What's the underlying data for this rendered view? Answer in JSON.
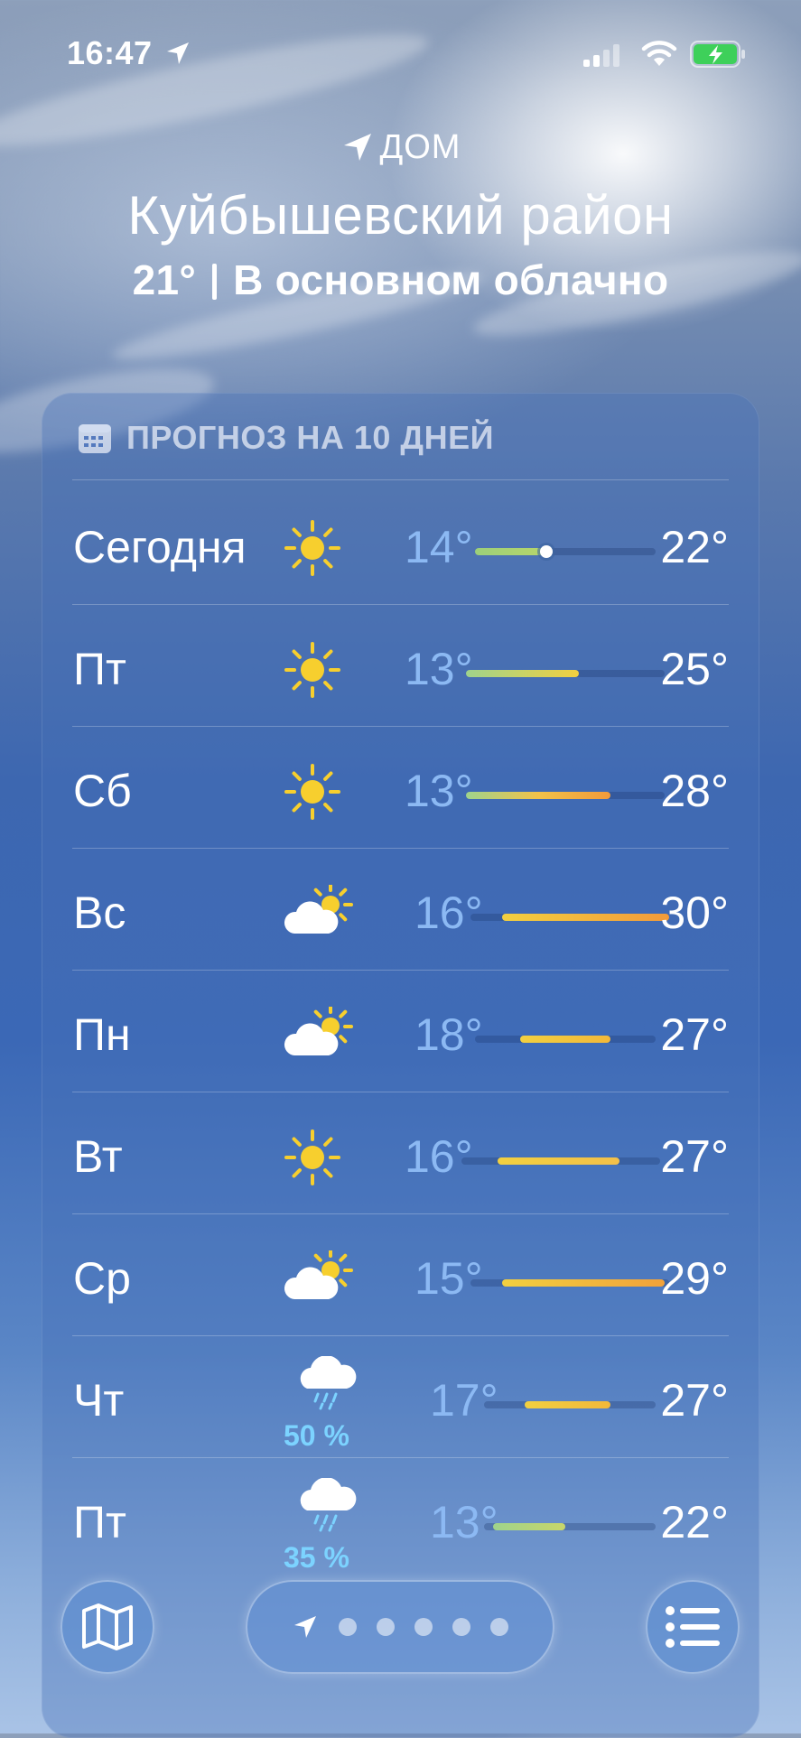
{
  "status_bar": {
    "time": "16:47"
  },
  "header": {
    "home_label": "ДОМ",
    "city": "Куйбышевский район",
    "current_temp": "21°",
    "condition": "В основном облачно"
  },
  "forecast": {
    "title": "ПРОГНОЗ НА 10 ДНЕЙ",
    "days": [
      {
        "day": "Сегодня",
        "icon": "sun-icon",
        "low": "14°",
        "high": "22°",
        "precip": ""
      },
      {
        "day": "Пт",
        "icon": "sun-icon",
        "low": "13°",
        "high": "25°",
        "precip": ""
      },
      {
        "day": "Сб",
        "icon": "sun-icon",
        "low": "13°",
        "high": "28°",
        "precip": ""
      },
      {
        "day": "Вс",
        "icon": "partly-cloudy-icon",
        "low": "16°",
        "high": "30°",
        "precip": ""
      },
      {
        "day": "Пн",
        "icon": "partly-cloudy-icon",
        "low": "18°",
        "high": "27°",
        "precip": ""
      },
      {
        "day": "Вт",
        "icon": "sun-icon",
        "low": "16°",
        "high": "27°",
        "precip": ""
      },
      {
        "day": "Ср",
        "icon": "partly-cloudy-icon",
        "low": "15°",
        "high": "29°",
        "precip": ""
      },
      {
        "day": "Чт",
        "icon": "rain-cloud-icon",
        "low": "17°",
        "high": "27°",
        "precip": "50 %"
      },
      {
        "day": "Пт",
        "icon": "rain-cloud-icon",
        "low": "13°",
        "high": "22°",
        "precip": "35 %"
      }
    ]
  },
  "bottom_bar": {
    "map_icon": "map-icon",
    "location_icon": "location-arrow-icon",
    "list_icon": "list-icon",
    "page_count": 5,
    "current_page": 0
  },
  "colors": {
    "low_temp": "#8cb9f3",
    "precip": "#7cd3ff",
    "sun": "#f7cf2e"
  }
}
